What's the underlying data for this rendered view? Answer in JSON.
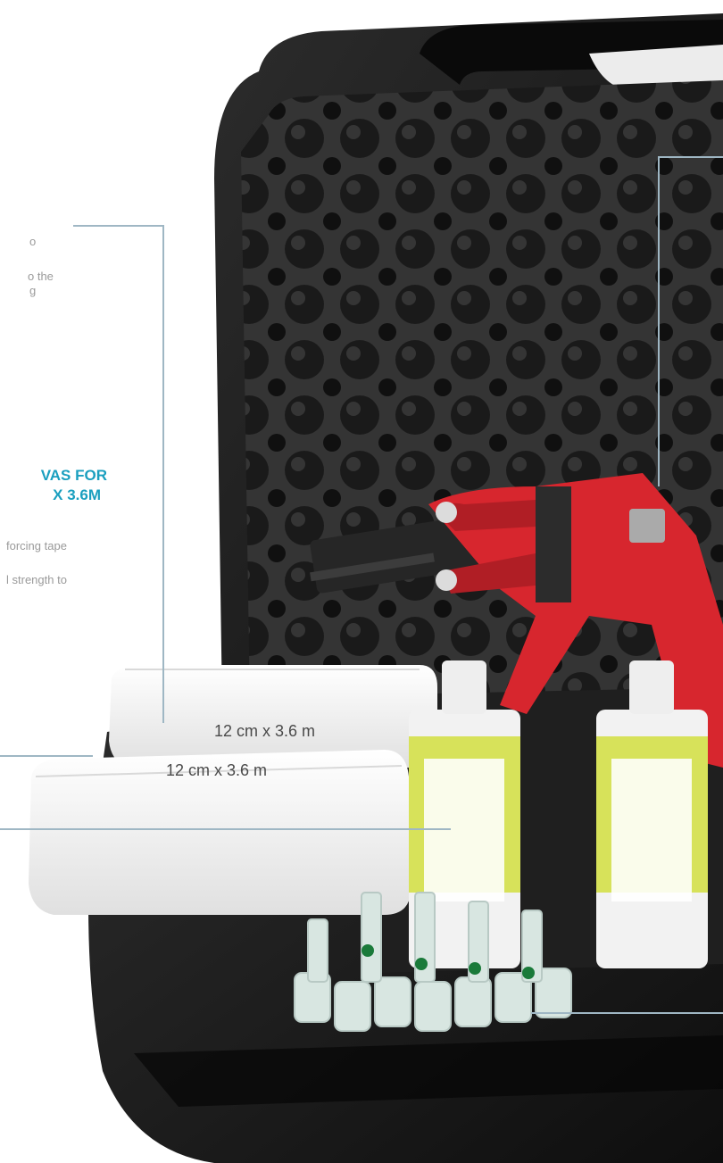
{
  "desc_top": {
    "line1": "o",
    "line2": "o the",
    "line3": "g"
  },
  "canvas_heading": {
    "line1": "VAS FOR",
    "line2": "X 3.6M"
  },
  "canvas_desc": {
    "line1": "forcing tape",
    "line2": "l strength to"
  },
  "roll_labels": [
    "12 cm x 3.6 m",
    "12 cm x 3.6 m"
  ],
  "colors": {
    "accent": "#1a9fbf",
    "gun": "#d7262e",
    "case": "#1c1c1c",
    "foam": "#2a2a2a",
    "canvas": "#f4f4f4",
    "cartridge_label": "#d7e25a",
    "leader_line": "#9fb7c4"
  }
}
